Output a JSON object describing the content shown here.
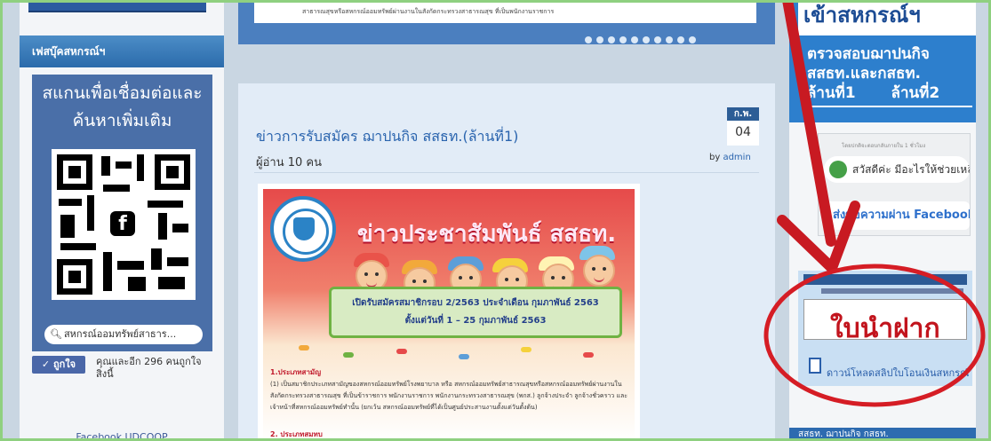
{
  "left_sidebar": {
    "fb_header": "เฟสบุ๊คสหกรณ์ฯ",
    "fb_card_title_line1": "สแกนเพื่อเชื่อมต่อและ",
    "fb_card_title_line2": "ค้นหาเพิ่มเติม",
    "search_label": "สหกรณ์ออมทรัพย์สาธาร...",
    "like_button": "ถูกใจ",
    "like_text": "คุณและอีก 296 คนถูกใจสิ่งนี้",
    "footer": "Facebook UDCOOP"
  },
  "slider": {
    "caption": "สาธารณสุขหรือสหกรณ์ออมทรัพย์ผ่านงานในสังกัดกระทรวงสาธารณสุข ที่เป็นพนักงานราชการ",
    "slide_count": 10
  },
  "post": {
    "title": "ข่าวการรับสมัคร ฌาปนกิจ สสธท.(ล้านที่1)",
    "date_month": "ก.พ.",
    "date_day": "04",
    "readers": "ผู้อ่าน 10 คน",
    "byline_prefix": "by",
    "byline_author": "admin"
  },
  "poster": {
    "headline": "ข่าวประชาสัมพันธ์ สสธท.",
    "banner_line1": "เปิดรับสมัครสมาชิกรอบ 2/2563 ประจำเดือน กุมภาพันธ์ 2563",
    "banner_line2": "ตั้งแต่วันที่ 1 – 25 กุมภาพันธ์ 2563",
    "section1": "1.ประเภทสามัญ",
    "section1_text": "(1) เป็นสมาชิกประเภทสามัญของสหกรณ์ออมทรัพย์โรงพยาบาล หรือ สหกรณ์ออมทรัพย์สาธารณสุขหรือสหกรณ์ออมทรัพย์ผ่านงานในสังกัดกระทรวงสาธารณสุข ที่เป็นข้าราชการ พนักงานราชการ พนักงานกระทรวงสาธารณสุข (พกส.) ลูกจ้างประจำ ลูกจ้างชั่วคราว และ เจ้าหน้าที่สหกรณ์ออมทรัพย์ทำนั้น (ยกเว้น สหกรณ์ออมทรัพย์ที่ได้เป็นศูนย์ประสานงานตั้งแต่วันตั้งต้น)",
    "section2": "2. ประเภทสมทบ"
  },
  "right_sidebar": {
    "banner_top": "เข้าสหกรณ์ฯ",
    "banner_line1": "ตรวจสอบฌาปนกิจ",
    "banner_line2": "สสธท.และกสธท.",
    "banner_line3": "ล้านที่1",
    "banner_line4": "ล้านที่2",
    "chat_note": "โดยปกติจะตอบกลับภายใน 1 ชั่วโมง",
    "chat_greeting": "สวัสดีค่ะ มีอะไรให้ช่วยเหลือ",
    "chat_fb": "ส่งข้อความผ่าน Facebook",
    "doc_label": "ใบนำฝาก",
    "doc_link": "ดาวน์โหลดสลิปใบโอนเงินสหกรณ์",
    "bottom_header": "สสธท. ฌาปนกิจ กสธท."
  },
  "colors": {
    "brand_blue": "#2b6bab",
    "annotation_red": "#d51d25",
    "poster_red": "#e64a4a"
  }
}
